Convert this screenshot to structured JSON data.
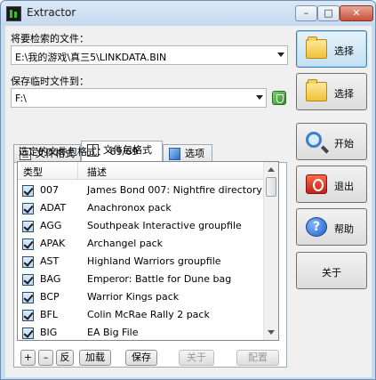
{
  "window": {
    "title": "Extractor",
    "minimize": "–",
    "maximize": "□",
    "close": "✕"
  },
  "source": {
    "label": "将要检索的文件：",
    "value": "E:\\我的游戏\\真三5\\LINKDATA.BIN"
  },
  "temp": {
    "label": "保存临时文件到：",
    "value": "F:\\"
  },
  "tabs": [
    {
      "label": "文件格式"
    },
    {
      "label": "文件包格式"
    },
    {
      "label": "选项"
    }
  ],
  "selected_count": "选定的文件包格式： 69/69",
  "list": {
    "col_type": "类型",
    "col_desc": "描述",
    "rows": [
      {
        "code": "007",
        "desc": "James Bond 007: Nightfire directory"
      },
      {
        "code": "ADAT",
        "desc": "Anachronox pack"
      },
      {
        "code": "AGG",
        "desc": "Southpeak Interactive groupfile"
      },
      {
        "code": "APAK",
        "desc": "Archangel pack"
      },
      {
        "code": "AST",
        "desc": "Highland Warriors groupfile"
      },
      {
        "code": "BAG",
        "desc": "Emperor: Battle for Dune bag"
      },
      {
        "code": "BCP",
        "desc": "Warrior Kings pack"
      },
      {
        "code": "BFL",
        "desc": "Colin McRae Rally 2 pack"
      },
      {
        "code": "BIG",
        "desc": "EA Big File"
      }
    ]
  },
  "bottom_buttons": {
    "plus": "+",
    "minus": "–",
    "invert": "反",
    "load": "加载",
    "save": "保存",
    "about": "关于",
    "config": "配置"
  },
  "side_buttons": {
    "select1": "选择",
    "select2": "选择",
    "start": "开始",
    "exit": "退出",
    "help": "帮助",
    "about": "关于"
  },
  "help_glyph": "?",
  "colors": {
    "window_frame": "#c9dcef",
    "focus_button": "#c4e0f3"
  }
}
